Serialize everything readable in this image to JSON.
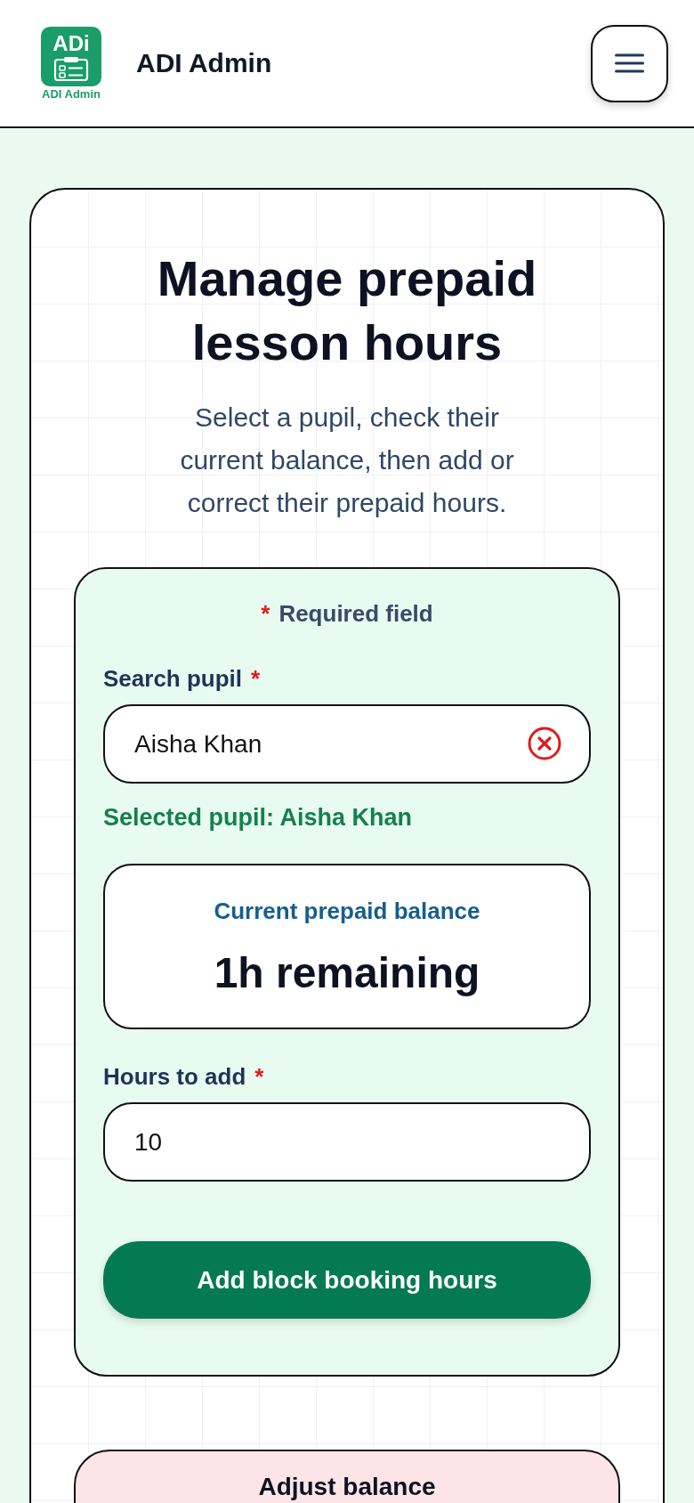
{
  "header": {
    "logo": {
      "mark": "ADi",
      "caption": "ADI Admin"
    },
    "title": "ADI Admin"
  },
  "intro": {
    "title": "Manage prepaid lesson hours",
    "subtitle": "Select a pupil, check their current balance, then add or correct their prepaid hours."
  },
  "add_form": {
    "required_marker": "*",
    "required_note": "Required field",
    "search": {
      "label": "Search pupil",
      "required": true,
      "value": "Aisha Khan"
    },
    "selection_note": "Selected pupil: Aisha Khan",
    "balance": {
      "label": "Current prepaid balance",
      "value": "1h remaining"
    },
    "hours": {
      "label": "Hours to add",
      "required": true,
      "value": "10"
    },
    "submit_button": "Add block booking hours"
  },
  "adjust_form": {
    "title": "Adjust balance"
  }
}
